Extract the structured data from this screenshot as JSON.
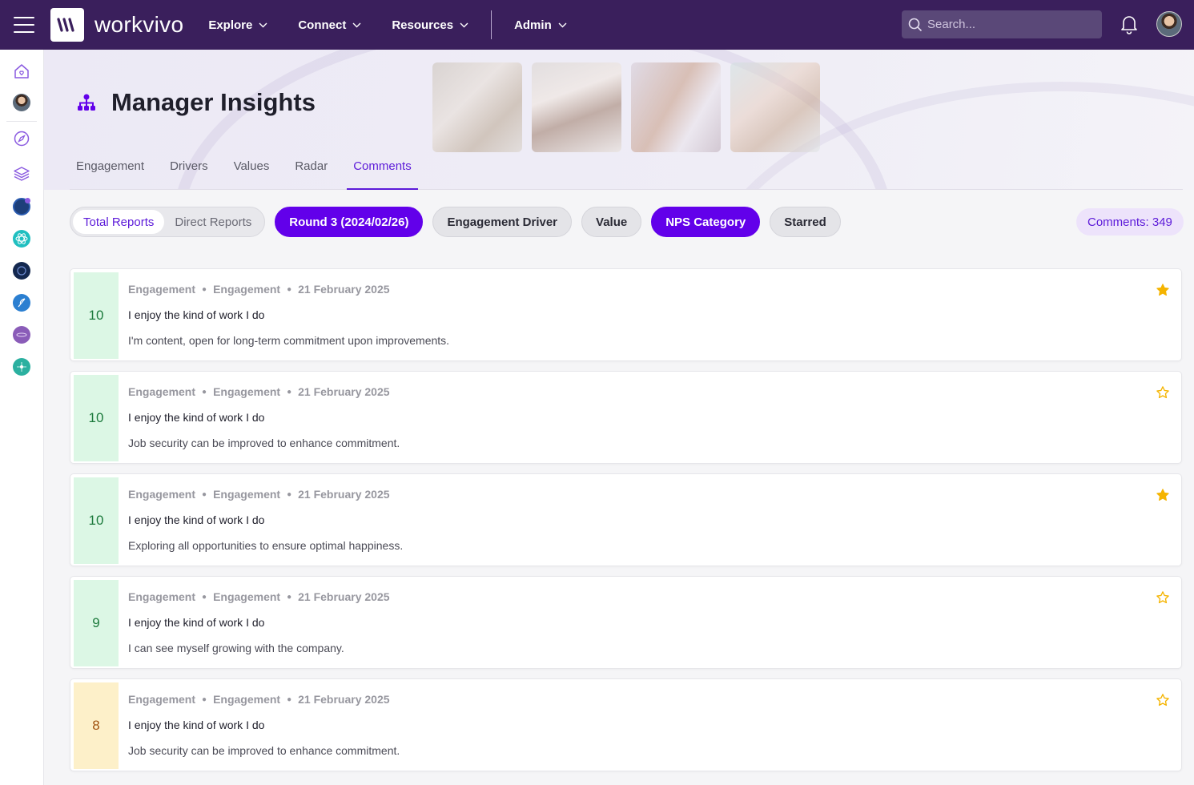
{
  "app": {
    "name": "workvivo"
  },
  "nav": {
    "items": [
      {
        "label": "Explore"
      },
      {
        "label": "Connect"
      },
      {
        "label": "Resources"
      },
      {
        "label": "Admin"
      }
    ],
    "search_placeholder": "Search..."
  },
  "page": {
    "title": "Manager Insights",
    "tabs": [
      {
        "label": "Engagement",
        "active": false
      },
      {
        "label": "Drivers",
        "active": false
      },
      {
        "label": "Values",
        "active": false
      },
      {
        "label": "Radar",
        "active": false
      },
      {
        "label": "Comments",
        "active": true
      }
    ]
  },
  "filters": {
    "segment": [
      {
        "label": "Total Reports",
        "active": true
      },
      {
        "label": "Direct Reports",
        "active": false
      }
    ],
    "chips": [
      {
        "label": "Round 3 (2024/02/26)",
        "selected": true
      },
      {
        "label": "Engagement Driver",
        "selected": false
      },
      {
        "label": "Value",
        "selected": false
      },
      {
        "label": "NPS Category",
        "selected": true
      },
      {
        "label": "Starred",
        "selected": false
      }
    ],
    "comments_count": "Comments: 349"
  },
  "colors": {
    "topbar": "#3a1f5c",
    "accent": "#6200ea",
    "star": "#f5b400",
    "promoter_bg": "#dcf7e5",
    "passive_bg": "#fdf0c9"
  },
  "comments": [
    {
      "score": "10",
      "category": "green",
      "driver": "Engagement",
      "value": "Engagement",
      "date": "21 February 2025",
      "question": "I enjoy the kind of work I do",
      "answer": "I'm content, open for long-term commitment upon improvements.",
      "starred": true
    },
    {
      "score": "10",
      "category": "green",
      "driver": "Engagement",
      "value": "Engagement",
      "date": "21 February 2025",
      "question": "I enjoy the kind of work I do",
      "answer": "Job security can be improved to enhance commitment.",
      "starred": false
    },
    {
      "score": "10",
      "category": "green",
      "driver": "Engagement",
      "value": "Engagement",
      "date": "21 February 2025",
      "question": "I enjoy the kind of work I do",
      "answer": "Exploring all opportunities to ensure optimal happiness.",
      "starred": true
    },
    {
      "score": "9",
      "category": "green",
      "driver": "Engagement",
      "value": "Engagement",
      "date": "21 February 2025",
      "question": "I enjoy the kind of work I do",
      "answer": "I can see myself growing with the company.",
      "starred": false
    },
    {
      "score": "8",
      "category": "yellow",
      "driver": "Engagement",
      "value": "Engagement",
      "date": "21 February 2025",
      "question": "I enjoy the kind of work I do",
      "answer": "Job security can be improved to enhance commitment.",
      "starred": false
    }
  ]
}
